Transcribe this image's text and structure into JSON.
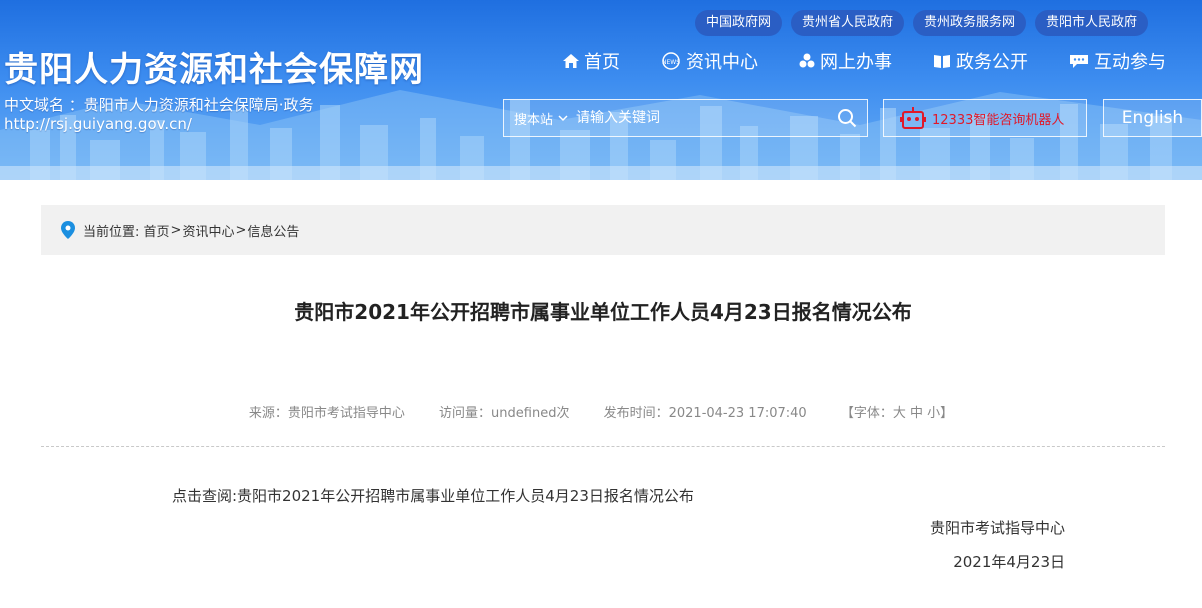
{
  "header": {
    "site_title": "贵阳人力资源和社会保障网",
    "domain_line1": "中文域名 ：贵阳市人力资源和社会保障局·政务",
    "domain_line2": "http://rsj.guiyang.gov.cn/",
    "gov_links": [
      "中国政府网",
      "贵州省人民政府",
      "贵州政务服务网",
      "贵阳市人民政府"
    ],
    "nav": [
      {
        "label": "首页",
        "icon": "home-icon"
      },
      {
        "label": "资讯中心",
        "icon": "news-icon"
      },
      {
        "label": "网上办事",
        "icon": "service-icon"
      },
      {
        "label": "政务公开",
        "icon": "book-icon"
      },
      {
        "label": "互动参与",
        "icon": "chat-icon"
      }
    ],
    "search": {
      "scope": "搜本站",
      "placeholder": "请输入关键词"
    },
    "robot_label": "12333智能咨询机器人",
    "english_label": "English"
  },
  "breadcrumb": {
    "prefix": "当前位置:",
    "items": [
      "首页",
      "资讯中心",
      "信息公告"
    ],
    "sep": ">"
  },
  "article": {
    "title": "贵阳市2021年公开招聘市属事业单位工作人员4月23日报名情况公布",
    "meta": {
      "source": "来源：贵阳市考试指导中心",
      "views": "访问量：undefined次",
      "published": "发布时间：2021-04-23 17:07:40",
      "font_size": "【字体：大 中 小】"
    },
    "link_text": "点击查阅:贵阳市2021年公开招聘市属事业单位工作人员4月23日报名情况公布",
    "signature": "贵阳市考试指导中心",
    "date": "2021年4月23日"
  },
  "colors": {
    "banner": "#3d8df0",
    "gov_link_bg": "#2a5ec4",
    "robot_text": "#e0192a"
  }
}
